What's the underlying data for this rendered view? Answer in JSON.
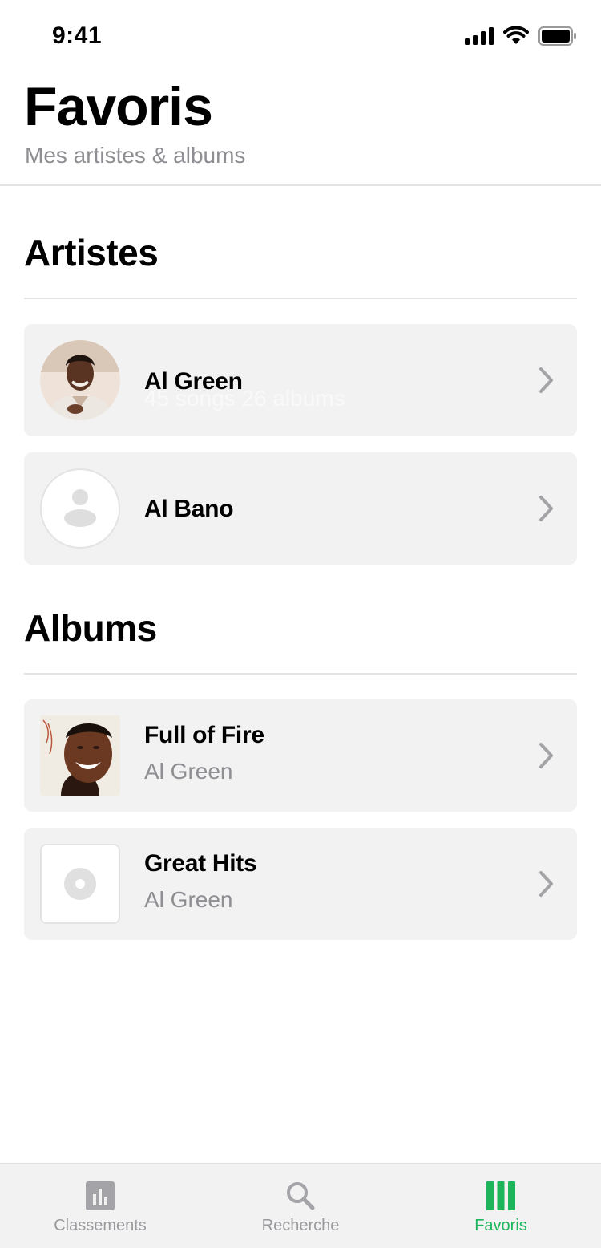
{
  "status_bar": {
    "time": "9:41"
  },
  "header": {
    "title": "Favoris",
    "subtitle": "Mes artistes & albums"
  },
  "sections": {
    "artists_title": "Artistes",
    "albums_title": "Albums"
  },
  "artists": [
    {
      "name": "Al Green",
      "meta": "45 songs 26 albums",
      "photo": "artist-photo"
    },
    {
      "name": "Al Bano",
      "photo": "person-placeholder-icon"
    }
  ],
  "albums": [
    {
      "title": "Full of Fire",
      "artist": "Al Green",
      "cover": "album-cover"
    },
    {
      "title": "Great Hits",
      "artist": "Al Green",
      "cover": "vinyl-placeholder-icon"
    }
  ],
  "tab_bar": {
    "tabs": [
      {
        "label": "Classements",
        "icon": "chart-icon",
        "active": false
      },
      {
        "label": "Recherche",
        "icon": "search-icon",
        "active": false
      },
      {
        "label": "Favoris",
        "icon": "library-icon",
        "active": true
      }
    ]
  },
  "colors": {
    "accent": "#1db45a",
    "card_background": "#f2f2f2",
    "secondary_text": "#8e8e93",
    "inactive_tab": "#9a9a9e"
  }
}
